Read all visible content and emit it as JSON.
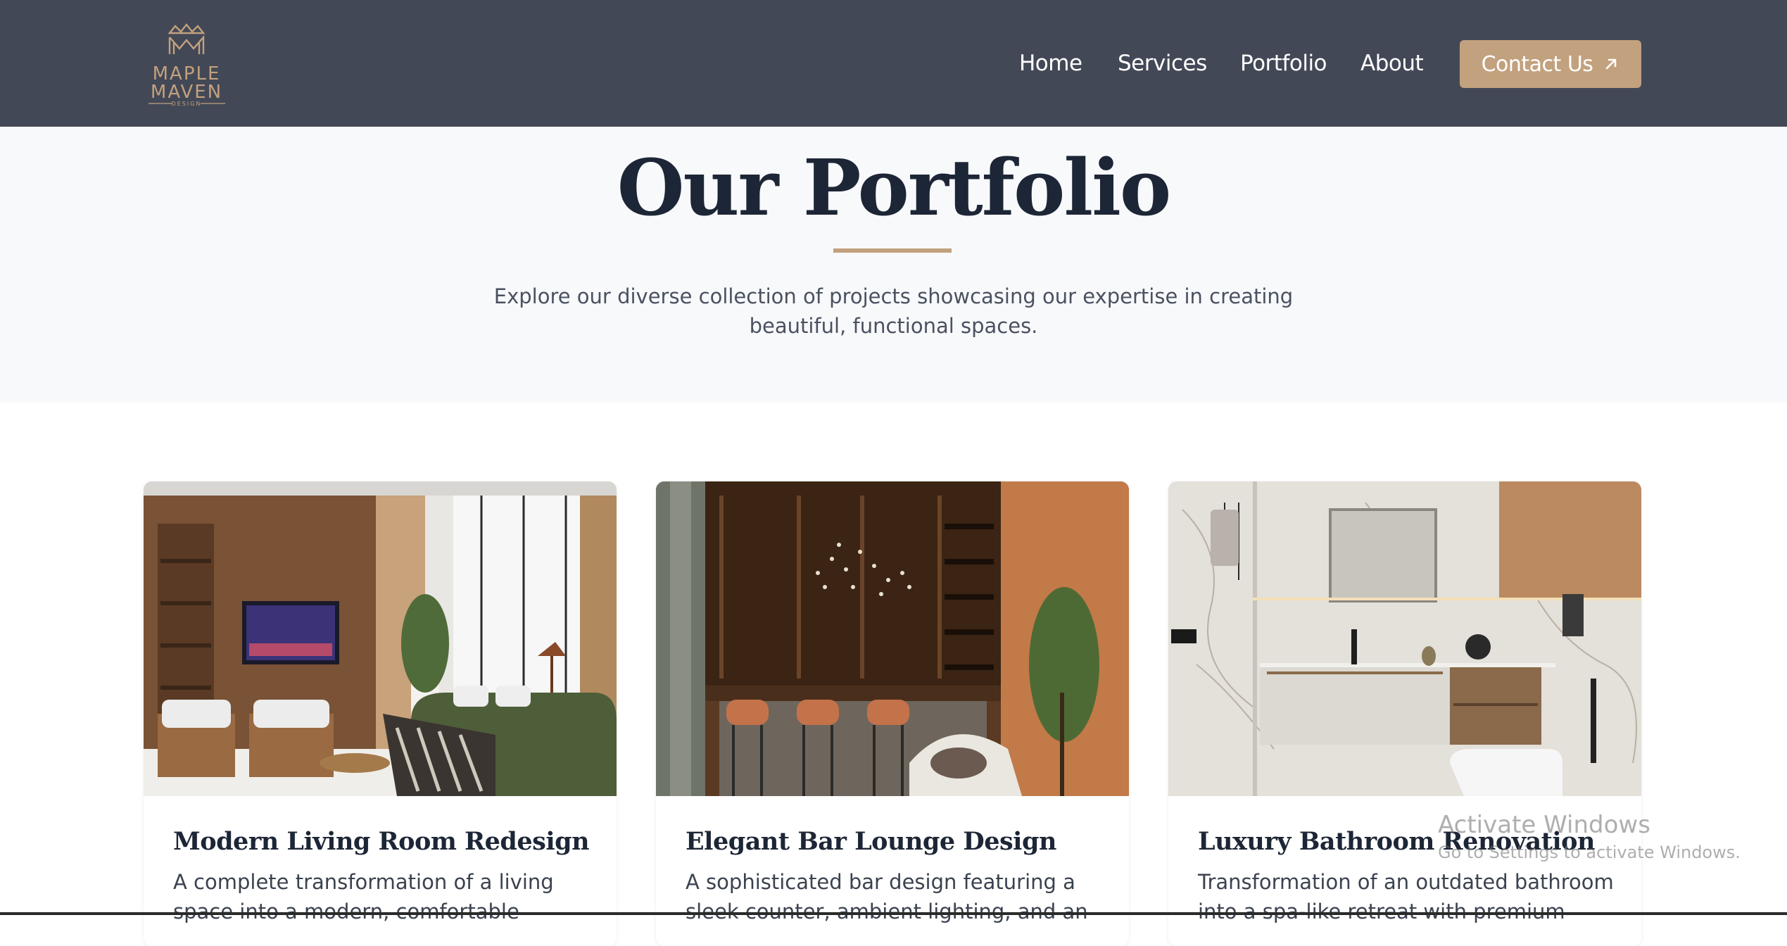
{
  "brand": {
    "line1": "MAPLE",
    "line2": "MAVEN",
    "line3": "DESIGN",
    "logo_icon": "crown-monogram-logo"
  },
  "nav": {
    "items": [
      {
        "label": "Home"
      },
      {
        "label": "Services"
      },
      {
        "label": "Portfolio"
      },
      {
        "label": "About"
      }
    ],
    "cta_label": "Contact Us",
    "cta_icon": "arrow-up-right-icon"
  },
  "hero": {
    "title": "Our Portfolio",
    "subtitle": "Explore our diverse collection of projects showcasing our expertise in creating beautiful, functional spaces."
  },
  "projects": [
    {
      "title": "Modern Living Room Redesign",
      "description": "A complete transformation of a living space into a modern, comfortable"
    },
    {
      "title": "Elegant Bar Lounge Design",
      "description": "A sophisticated bar design featuring a sleek counter, ambient lighting, and an"
    },
    {
      "title": "Luxury Bathroom Renovation",
      "description": "Transformation of an outdated bathroom into a spa-like retreat with premium"
    }
  ],
  "watermark": {
    "title": "Activate Windows",
    "subtitle": "Go to Settings to activate Windows."
  },
  "colors": {
    "navbar": "#434856",
    "accent": "#c2a17e",
    "heading": "#1d2636",
    "hero_bg": "#f8f9fb"
  }
}
